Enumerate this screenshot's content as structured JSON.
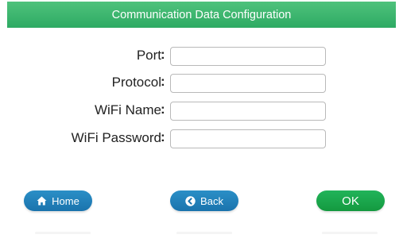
{
  "header": {
    "title": "Communication Data Configuration"
  },
  "form": {
    "colon": ":",
    "fields": [
      {
        "label": "Port",
        "value": "",
        "placeholder": ""
      },
      {
        "label": "Protocol",
        "value": "",
        "placeholder": ""
      },
      {
        "label": "WiFi Name",
        "value": "",
        "placeholder": ""
      },
      {
        "label": "WiFi Password",
        "value": "",
        "placeholder": ""
      }
    ]
  },
  "buttons": {
    "home_label": "Home",
    "back_label": "Back",
    "ok_label": "OK"
  },
  "colors": {
    "header_bg": "#2eaa63",
    "button_blue": "#1a73ad",
    "button_green": "#14993f"
  },
  "icons": {
    "home": "home-icon",
    "back": "back-arrow-icon"
  }
}
